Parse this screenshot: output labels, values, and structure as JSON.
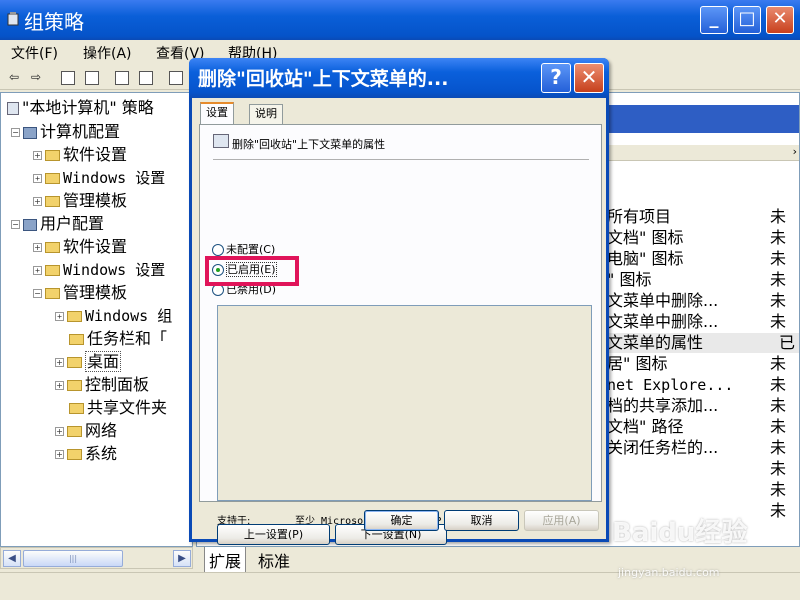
{
  "window": {
    "title": "组策略",
    "min_icon": "_",
    "max_icon": "□",
    "close_icon": "✕"
  },
  "menubar": [
    "文件(F)",
    "操作(A)",
    "查看(V)",
    "帮助(H)"
  ],
  "tree": {
    "root": "\"本地计算机\" 策略",
    "items": [
      {
        "label": "计算机配置"
      },
      {
        "label": "软件设置"
      },
      {
        "label": "Windows 设置"
      },
      {
        "label": "管理模板"
      },
      {
        "label": "用户配置"
      },
      {
        "label": "软件设置"
      },
      {
        "label": "Windows 设置"
      },
      {
        "label": "管理模板"
      },
      {
        "label": "Windows 组"
      },
      {
        "label": "任务栏和「"
      },
      {
        "label": "桌面"
      },
      {
        "label": "控制面板"
      },
      {
        "label": "共享文件夹"
      },
      {
        "label": "网络"
      },
      {
        "label": "系统"
      }
    ]
  },
  "list": {
    "rows": [
      {
        "name": "所有项目",
        "state": "未"
      },
      {
        "name": "文档\" 图标",
        "state": "未"
      },
      {
        "name": "电脑\" 图标",
        "state": "未"
      },
      {
        "name": "\" 图标",
        "state": "未"
      },
      {
        "name": "文菜单中删除...",
        "state": "未"
      },
      {
        "name": "文菜单中删除...",
        "state": "未"
      },
      {
        "name": "文菜单的属性",
        "state": "已"
      },
      {
        "name": "居\" 图标",
        "state": "未"
      },
      {
        "name": "net Explore...",
        "state": "未"
      },
      {
        "name": "档的共享添加...",
        "state": "未"
      },
      {
        "name": "文档\" 路径",
        "state": "未"
      },
      {
        "name": "关闭任务栏的...",
        "state": "未"
      },
      {
        "name": "",
        "state": "未"
      },
      {
        "name": "",
        "state": "未"
      },
      {
        "name": "",
        "state": "未"
      }
    ]
  },
  "bottom_tabs": [
    "扩展",
    "标准"
  ],
  "dialog": {
    "title": "删除\"回收站\"上下文菜单的...",
    "help_icon": "?",
    "close_icon": "✕",
    "tabs": [
      "设置",
      "说明"
    ],
    "policy_name": "删除\"回收站\"上下文菜单的属性",
    "options": {
      "not_configured": "未配置(C)",
      "enabled": "已启用(E)",
      "disabled": "已禁用(D)"
    },
    "supported_label": "支持于:",
    "supported_value": "至少 Microsoft Windows XP Professional 或...",
    "prev_button": "上一设置(P)",
    "next_button": "下一设置(N)",
    "ok_button": "确定",
    "cancel_button": "取消",
    "apply_button": "应用(A)"
  },
  "watermark": {
    "logo": "Baidu经验",
    "url": "jingyan.baidu.com"
  }
}
